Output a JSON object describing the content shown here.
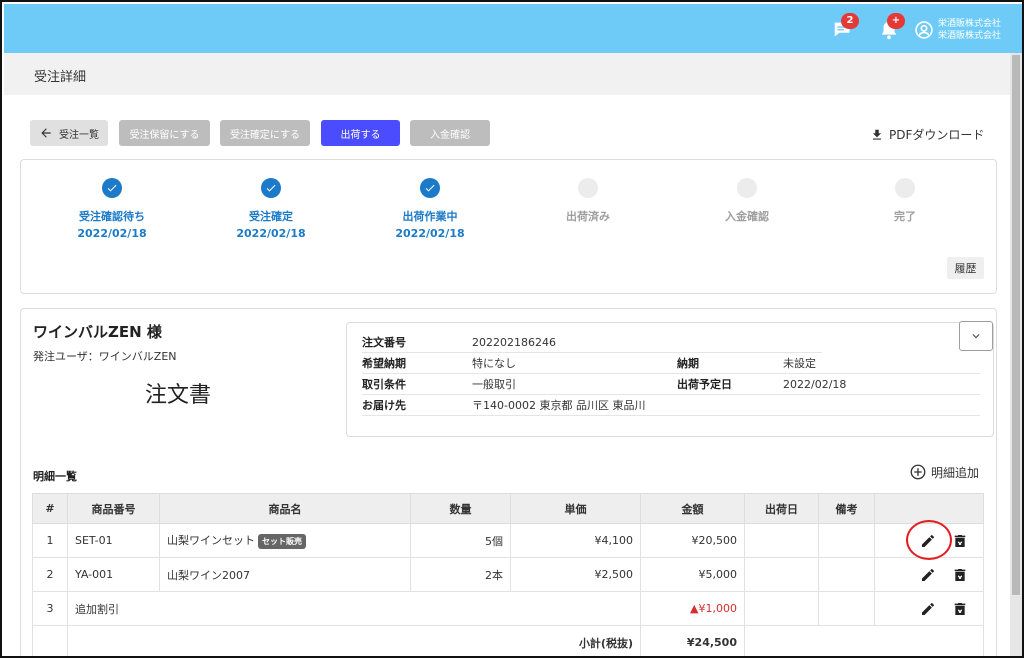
{
  "topbar": {
    "chat_badge": "2",
    "bell_badge": "+",
    "user_line1": "栄酒販株式会社",
    "user_line2": "栄酒販株式会社",
    "bg_color": "#6ecbf8"
  },
  "page": {
    "title": "受注詳細"
  },
  "toolbar": {
    "back_label": "受注一覧",
    "hold_label": "受注保留にする",
    "confirm_label": "受注確定にする",
    "ship_label": "出荷する",
    "payment_label": "入金確認",
    "pdf_label": "PDFダウンロード",
    "primary_color": "#4c4cff"
  },
  "steps": [
    {
      "label": "受注確認待ち",
      "date": "2022/02/18",
      "status": "done"
    },
    {
      "label": "受注確定",
      "date": "2022/02/18",
      "status": "done"
    },
    {
      "label": "出荷作業中",
      "date": "2022/02/18",
      "status": "done"
    },
    {
      "label": "出荷済み",
      "date": "",
      "status": "todo"
    },
    {
      "label": "入金確認",
      "date": "",
      "status": "todo"
    },
    {
      "label": "完了",
      "date": "",
      "status": "todo"
    }
  ],
  "history_label": "履歴",
  "customer": {
    "name": "ワインバルZEN 様",
    "user": "発注ユーザ：ワインバルZEN",
    "doc_title": "注文書"
  },
  "order_info": {
    "order_no_label": "注文番号",
    "order_no": "202202186246",
    "desired_date_label": "希望納期",
    "desired_date": "特になし",
    "due_label": "納期",
    "due": "未設定",
    "terms_label": "取引条件",
    "terms": "一般取引",
    "ship_plan_label": "出荷予定日",
    "ship_plan": "2022/02/18",
    "dest_label": "お届け先",
    "dest": "〒140-0002  東京都 品川区 東品川"
  },
  "details": {
    "title": "明細一覧",
    "add_label": "明細追加",
    "headers": {
      "no": "#",
      "code": "商品番号",
      "name": "商品名",
      "qty": "数量",
      "price": "単価",
      "amount": "金額",
      "ship_date": "出荷日",
      "note": "備考"
    },
    "rows": [
      {
        "no": "1",
        "code": "SET-01",
        "name": "山梨ワインセット",
        "tag": "セット販売",
        "qty": "5個",
        "price": "¥4,100",
        "amount": "¥20,500"
      },
      {
        "no": "2",
        "code": "YA-001",
        "name": "山梨ワイン2007",
        "qty": "2本",
        "price": "¥2,500",
        "amount": "¥5,000"
      },
      {
        "no": "3",
        "name": "追加割引",
        "amount": "▲¥1,000"
      }
    ],
    "subtotal_label": "小計(税抜)",
    "subtotal": "¥24,500"
  }
}
